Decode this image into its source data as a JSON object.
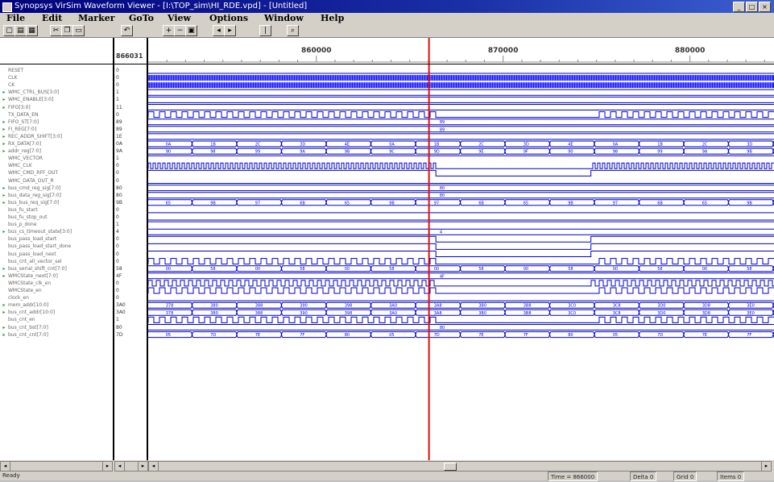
{
  "window": {
    "title": "Synopsys VirSim Waveform Viewer - [I:\\TOP_sim\\HI_RDE.vpd] - [Untitled]",
    "controls": [
      "_",
      "□",
      "×"
    ]
  },
  "menu": [
    {
      "label": "File"
    },
    {
      "label": "Edit"
    },
    {
      "label": "Marker"
    },
    {
      "label": "GoTo"
    },
    {
      "label": "View"
    },
    {
      "label": "Options"
    },
    {
      "label": "Window"
    },
    {
      "label": "Help"
    }
  ],
  "toolbar": {
    "buttons": [
      {
        "icon": "open-icon",
        "glyph": "▢"
      },
      {
        "icon": "save-icon",
        "glyph": "▤"
      },
      {
        "icon": "print-icon",
        "glyph": "▦"
      },
      {
        "icon": "cut-icon",
        "glyph": "✂"
      },
      {
        "icon": "copy-icon",
        "glyph": "❐"
      },
      {
        "icon": "paste-icon",
        "glyph": "▭"
      },
      {
        "icon": "undo-icon",
        "glyph": "↶"
      },
      {
        "icon": "zoom-in-icon",
        "glyph": "+"
      },
      {
        "icon": "zoom-out-icon",
        "glyph": "−"
      },
      {
        "icon": "zoom-full-icon",
        "glyph": "▣"
      },
      {
        "icon": "prev-edge-icon",
        "glyph": "◂"
      },
      {
        "icon": "next-edge-icon",
        "glyph": "▸"
      },
      {
        "icon": "marker-icon",
        "glyph": "|"
      },
      {
        "icon": "search-icon",
        "glyph": "⌕"
      }
    ]
  },
  "header": {
    "value_column_time": "866031",
    "time_labels": [
      "860000",
      "870000",
      "880000"
    ]
  },
  "signals": [
    {
      "name": "RESET",
      "value": "0",
      "type": "bit"
    },
    {
      "name": "CLK",
      "value": "0",
      "type": "bit"
    },
    {
      "name": "CK",
      "value": "0",
      "type": "bit"
    },
    {
      "name": "WMC_CTRL_BUS[3:0]",
      "value": "1",
      "type": "bus"
    },
    {
      "name": "WMC_ENABLE[3:0]",
      "value": "1",
      "type": "bus"
    },
    {
      "name": "FIFO[3:0]",
      "value": "11",
      "type": "bus"
    },
    {
      "name": "TX_DATA_EN",
      "value": "0",
      "type": "bit"
    },
    {
      "name": "FIFO_ST[7:0]",
      "value": "89",
      "type": "bus"
    },
    {
      "name": "FI_REG[7:0]",
      "value": "89",
      "type": "bus"
    },
    {
      "name": "REC_ADDR_SHIFT[3:0]",
      "value": "1E",
      "type": "bus"
    },
    {
      "name": "RX_DATA[7:0]",
      "value": "0A",
      "type": "bus"
    },
    {
      "name": "addr_reg[7:0]",
      "value": "9A",
      "type": "bus"
    },
    {
      "name": "WMC_VECTOR",
      "value": "1",
      "type": "bit"
    },
    {
      "name": "WMC_CLK",
      "value": "0",
      "type": "bit"
    },
    {
      "name": "WMC_CMD_RFF_OUT",
      "value": "0",
      "type": "bit"
    },
    {
      "name": "WMC_DATA_OUT_R",
      "value": "0",
      "type": "bit"
    },
    {
      "name": "bus_cmd_reg_sig[7:0]",
      "value": "80",
      "type": "bus"
    },
    {
      "name": "bus_data_reg_sig[7:0]",
      "value": "80",
      "type": "bus"
    },
    {
      "name": "bus_bus_req_sig[7:0]",
      "value": "9B",
      "type": "bus"
    },
    {
      "name": "bus_fu_start",
      "value": "0",
      "type": "bit"
    },
    {
      "name": "bus_fu_stop_out",
      "value": "0",
      "type": "bit"
    },
    {
      "name": "bus_p_done",
      "value": "1",
      "type": "bit"
    },
    {
      "name": "bus_cs_timeout_state[3:0]",
      "value": "4",
      "type": "bus"
    },
    {
      "name": "bus_pass_load_start",
      "value": "0",
      "type": "bit"
    },
    {
      "name": "bus_pass_load_start_done",
      "value": "0",
      "type": "bit"
    },
    {
      "name": "bus_pass_load_next",
      "value": "0",
      "type": "bit"
    },
    {
      "name": "bus_cnt_all_vector_sel",
      "value": "0",
      "type": "bit"
    },
    {
      "name": "bus_serial_shift_cnt[7:0]",
      "value": "58",
      "type": "bus"
    },
    {
      "name": "WMCState_next[7:0]",
      "value": "4F",
      "type": "bus"
    },
    {
      "name": "WMCState_clk_en",
      "value": "0",
      "type": "bit"
    },
    {
      "name": "WMCState_en",
      "value": "0",
      "type": "bit"
    },
    {
      "name": "clock_en",
      "value": "0",
      "type": "bit"
    },
    {
      "name": "mem_addr[10:0]",
      "value": "3A0",
      "type": "bus"
    },
    {
      "name": "bus_cnt_addr[10:0]",
      "value": "3A0",
      "type": "bus"
    },
    {
      "name": "bus_cnt_en",
      "value": "1",
      "type": "bit"
    },
    {
      "name": "bus_cnt_bst[7:0]",
      "value": "80",
      "type": "bus"
    },
    {
      "name": "bus_cnt_cnt[7:0]",
      "value": "7D",
      "type": "bus"
    }
  ],
  "bus_samples": {
    "FIFO_ST[7:0]": "89",
    "FI_REG[7:0]": "89",
    "bus_cmd_reg_sig[7:0]": "80",
    "bus_data_reg_sig[7:0]": "80",
    "bus_cs_timeout_state[3:0]": "4",
    "WMCState_next[7:0]": "4F",
    "bus_cnt_bst[7:0]": "80",
    "bus_bus_req_sig[7:0]": [
      "65",
      "9B",
      "97",
      "6B"
    ],
    "bus_serial_shift_cnt[7:0]": [
      "00",
      "58"
    ],
    "mem_addr[10:0]": [
      "378",
      "380",
      "388",
      "390",
      "398",
      "3A0",
      "3A8",
      "3B0",
      "3B8",
      "3C0",
      "3C8",
      "3D0",
      "3D8",
      "3E0"
    ],
    "bus_cnt_addr[10:0]": [
      "378",
      "380",
      "388",
      "390",
      "398",
      "3A0",
      "3A8",
      "3B0",
      "3B8",
      "3C0",
      "3C8",
      "3D0",
      "3D8",
      "3E0"
    ],
    "bus_cnt_cnt[7:0]": [
      "05",
      "7D",
      "7E",
      "7F",
      "80"
    ],
    "addr_reg[7:0]": [
      "90",
      "98",
      "99",
      "9A",
      "9B",
      "9C",
      "9D",
      "9E",
      "9F"
    ],
    "RX_DATA[7:0]": [
      "0A",
      "1B",
      "2C",
      "3D",
      "4E"
    ]
  },
  "cursor": {
    "time": "866031",
    "color": "#e01010"
  },
  "colors": {
    "wave": "#0000c8",
    "cursor": "#e01010",
    "green_arrow": "#2a8a2a",
    "dense": "#1a1aff"
  },
  "statusbar": {
    "left": "Ready",
    "time": "Time = 866000",
    "delta": "Delta 0",
    "grid": "Grid 0",
    "items": "Items 0"
  }
}
